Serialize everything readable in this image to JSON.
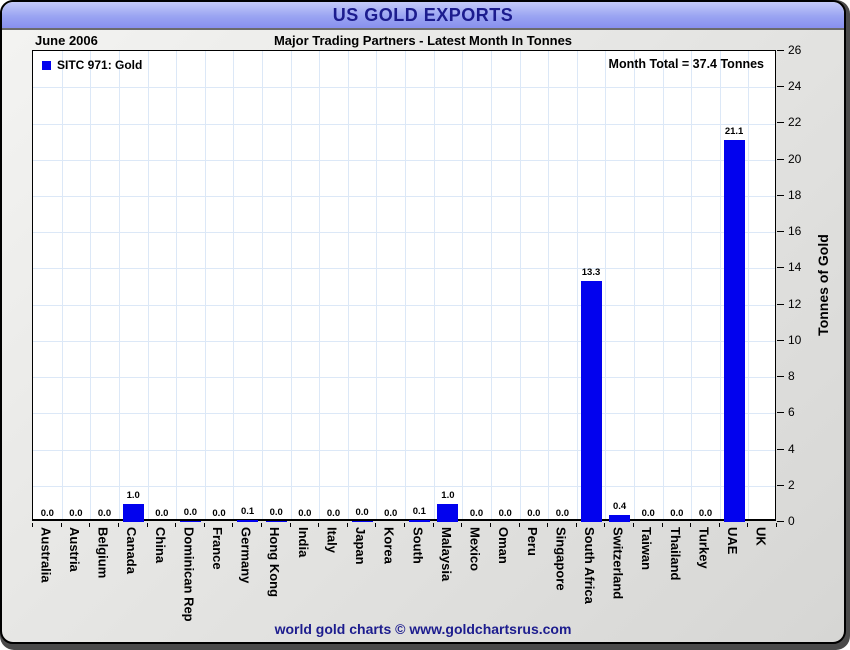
{
  "header": {
    "title": "US GOLD EXPORTS",
    "date": "June 2006",
    "subtitle": "Major Trading Partners - Latest Month In Tonnes"
  },
  "legend": {
    "label": "SITC 971: Gold",
    "swatch_color": "#0202ee"
  },
  "annotations": {
    "month_total": "Month Total = 37.4 Tonnes"
  },
  "axes": {
    "y_title": "Tonnes of Gold",
    "y_min": 0,
    "y_max": 26,
    "y_step": 2
  },
  "footer": {
    "text": "world gold charts © www.goldchartsrus.com"
  },
  "colors": {
    "bar": "#0202ee",
    "titlebar": "#9aa4f2",
    "navy_text": "#1c1c8e",
    "gridline": "#dce8f7"
  },
  "chart_data": {
    "type": "bar",
    "title": "US GOLD EXPORTS",
    "period": "June 2006",
    "subtitle": "Major Trading Partners - Latest Month In Tonnes",
    "series_name": "SITC 971: Gold",
    "month_total_tonnes": 37.4,
    "ylabel": "Tonnes of Gold",
    "ylim": [
      0,
      26
    ],
    "y_tick_step": 2,
    "grid": true,
    "legend_position": "top-left",
    "categories": [
      "Australia",
      "Austria",
      "Belgium",
      "Canada",
      "China",
      "Dominican Rep",
      "France",
      "Germany",
      "Hong Kong",
      "India",
      "Italy",
      "Japan",
      "Korea",
      "South",
      "Malaysia",
      "Mexico",
      "Oman",
      "Peru",
      "Singapore",
      "South Africa",
      "Switzerland",
      "Taiwan",
      "Thailand",
      "Turkey",
      "UAE",
      "UK"
    ],
    "values": [
      0.0,
      0.0,
      0.0,
      1.0,
      0.0,
      0.0,
      0.0,
      0.1,
      0.0,
      0.0,
      0.0,
      0.0,
      0.0,
      0.1,
      1.0,
      0.0,
      0.0,
      0.0,
      0.0,
      13.3,
      0.4,
      0.0,
      0.0,
      0.0,
      21.1,
      0.0
    ],
    "value_labels": [
      "0.0",
      "0.0",
      "0.0",
      "1.0",
      "0.0",
      "0.0",
      "0.0",
      "0.1",
      "0.0",
      "0.0",
      "0.0",
      "0.0",
      "0.0",
      "0.1",
      "1.0",
      "0.0",
      "0.0",
      "0.0",
      "0.0",
      "13.3",
      "0.4",
      "0.0",
      "0.0",
      "0.0",
      "21.1",
      ""
    ],
    "hairline_bar_indices": [
      5,
      8,
      11
    ]
  }
}
